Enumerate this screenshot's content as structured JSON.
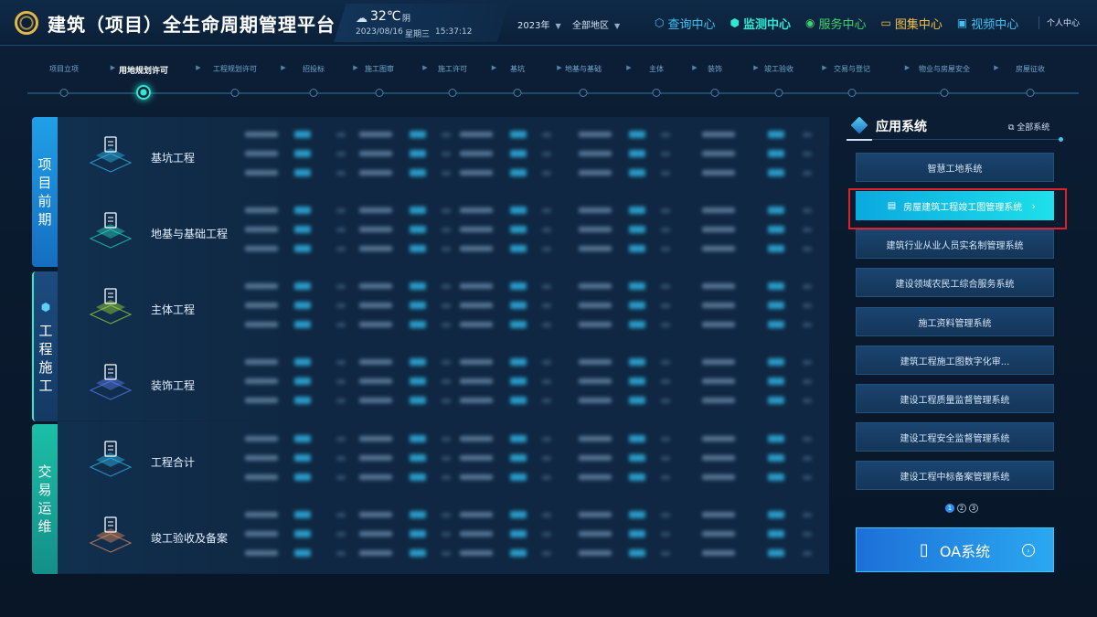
{
  "header": {
    "title": "建筑（项目）全生命周期管理平台",
    "weather": {
      "icon": "cloud-icon",
      "temp": "32℃",
      "condition": "阴",
      "date": "2023/08/16",
      "weekday": "星期三",
      "time": "15:37:12"
    },
    "year_select": "2023年",
    "region_select": "全部地区",
    "nav": [
      {
        "label": "查询中心",
        "icon": "cube-outline-icon"
      },
      {
        "label": "监测中心",
        "icon": "cube-icon"
      },
      {
        "label": "服务中心",
        "icon": "chat-icon"
      },
      {
        "label": "图集中心",
        "icon": "folder-icon"
      },
      {
        "label": "视频中心",
        "icon": "video-icon"
      }
    ],
    "user": "个人中心"
  },
  "timeline": {
    "active_index": 1,
    "steps": [
      "项目立项",
      "用地规划许可",
      "工程规划许可",
      "招投标",
      "施工图审",
      "施工许可",
      "基坑",
      "地基与基础",
      "主体",
      "装饰",
      "竣工验收",
      "交易与登记",
      "物业与房屋安全",
      "房屋征收"
    ]
  },
  "left_tabs": [
    "项目前期",
    "工程施工",
    "交易运维"
  ],
  "rows": [
    {
      "name": "基坑工程"
    },
    {
      "name": "地基与基础工程"
    },
    {
      "name": "主体工程"
    },
    {
      "name": "装饰工程"
    },
    {
      "name": "工程合计"
    },
    {
      "name": "竣工验收及备案"
    }
  ],
  "apps": {
    "title": "应用系统",
    "all_label": "全部系统",
    "items": [
      "智慧工地系统",
      "房屋建筑工程竣工图管理系统",
      "建筑行业从业人员实名制管理系统",
      "建设领域农民工综合服务系统",
      "施工资料管理系统",
      "建筑工程施工图数字化审...",
      "建设工程质量监督管理系统",
      "建设工程安全监督管理系统",
      "建设工程中标备案管理系统"
    ],
    "pages": [
      "1",
      "2",
      "3"
    ],
    "oa_label": "OA系统"
  },
  "colors": {
    "accent": "#2ee8d2",
    "highlight_border": "#e0202a"
  }
}
